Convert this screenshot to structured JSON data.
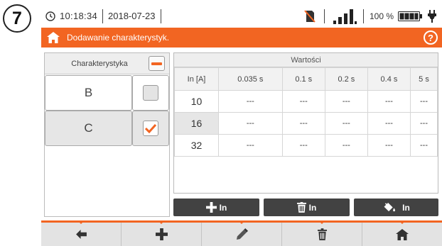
{
  "step_number": "7",
  "status": {
    "time": "10:18:34",
    "date": "2018-07-23",
    "battery_percent": "100 %",
    "signal_level": 4,
    "icons": [
      "clock-icon",
      "no-sd-card-icon",
      "signal-bars-icon",
      "battery-icon",
      "power-plug-icon"
    ]
  },
  "header": {
    "title": "Dodawanie charakterystyk.",
    "help_label": "?",
    "color": "#f26522"
  },
  "characteristics": {
    "header_label": "Charakterystyka",
    "items": [
      {
        "name": "B",
        "checked": false
      },
      {
        "name": "C",
        "checked": true
      }
    ]
  },
  "values": {
    "header_label": "Wartości",
    "columns": [
      "In [A]",
      "0.035 s",
      "0.1 s",
      "0.2 s",
      "0.4 s",
      "5 s"
    ],
    "rows": [
      {
        "in": "10",
        "cells": [
          "---",
          "---",
          "---",
          "---",
          "---"
        ]
      },
      {
        "in": "16",
        "cells": [
          "---",
          "---",
          "---",
          "---",
          "---"
        ]
      },
      {
        "in": "32",
        "cells": [
          "---",
          "---",
          "---",
          "---",
          "---"
        ]
      }
    ]
  },
  "actions": {
    "add_in_label": "In",
    "delete_in_label": "In",
    "fill_in_label": "In"
  },
  "toolbar": {
    "icons": [
      "arrow-left-icon",
      "plus-icon",
      "pencil-icon",
      "trash-icon",
      "home-icon"
    ]
  }
}
